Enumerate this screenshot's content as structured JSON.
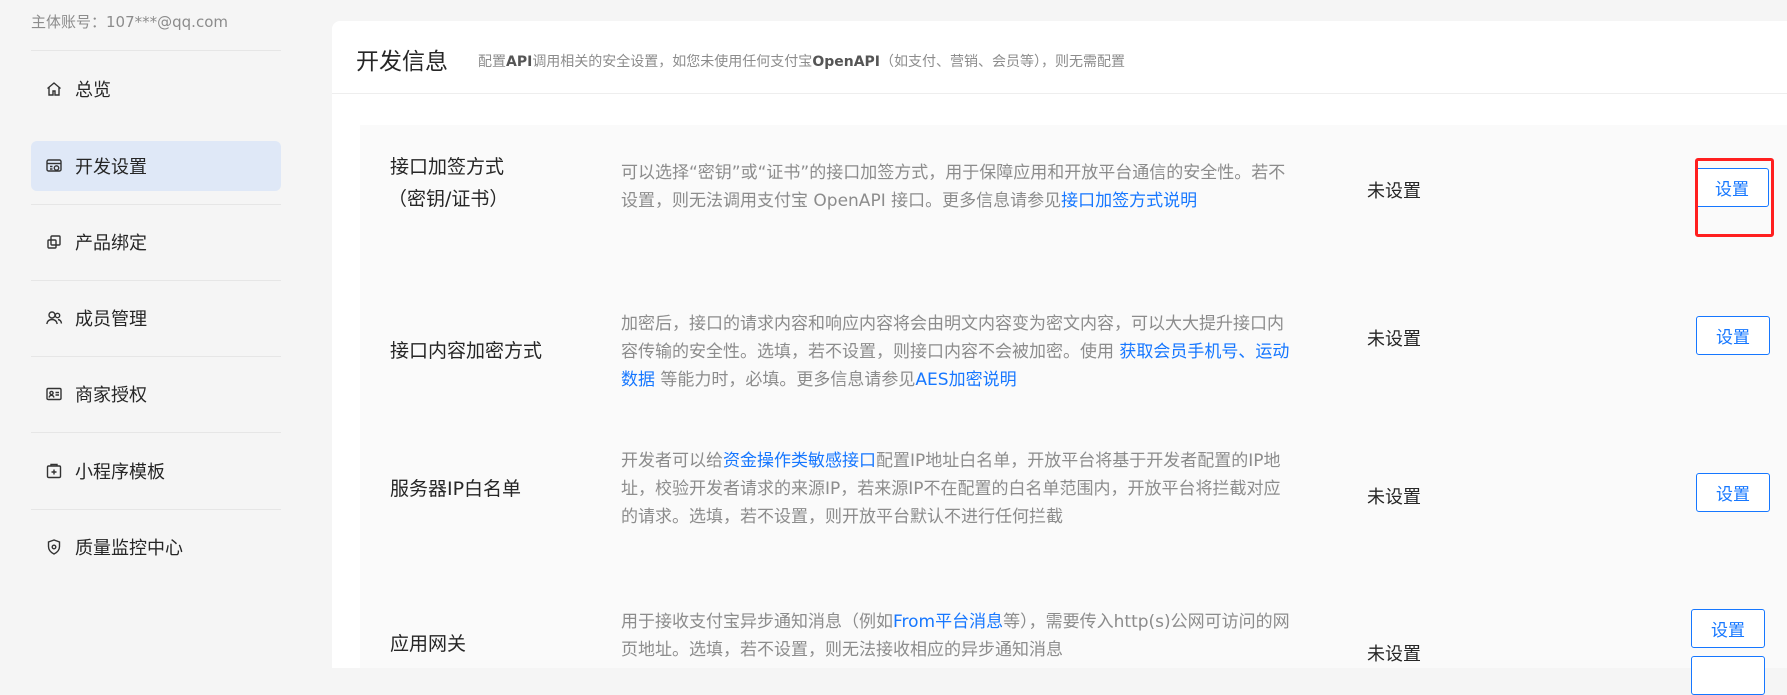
{
  "sidebar": {
    "account_label": "主体账号：107***@qq.com",
    "items": [
      {
        "label": "总览",
        "icon": "home-icon",
        "active": false
      },
      {
        "label": "开发设置",
        "icon": "dev-settings-icon",
        "active": true
      },
      {
        "label": "产品绑定",
        "icon": "product-bind-icon",
        "active": false
      },
      {
        "label": "成员管理",
        "icon": "members-icon",
        "active": false
      },
      {
        "label": "商家授权",
        "icon": "merchant-auth-icon",
        "active": false
      },
      {
        "label": "小程序模板",
        "icon": "miniapp-template-icon",
        "active": false
      },
      {
        "label": "质量监控中心",
        "icon": "shield-icon",
        "active": false
      }
    ]
  },
  "header": {
    "title": "开发信息",
    "desc_prefix": "配置",
    "desc_api": "API",
    "desc_middle": "调用相关的安全设置，如您未使用任何支付宝",
    "desc_openapi": "OpenAPI",
    "desc_suffix": "（如支付、营销、会员等），则无需配置"
  },
  "rows": [
    {
      "name_line1": "接口加签方式",
      "name_line2": "（密钥/证书）",
      "desc_line1": "可以选择“密钥”或“证书”的接口加签方式，用于保障应用和开放平台通信的安全性。若不",
      "desc_line2_text": "设置，则无法调用支付宝 OpenAPI 接口。更多信息请参见",
      "desc_line2_link": "接口加签方式说明",
      "status": "未设置",
      "button": "设置"
    },
    {
      "name": "接口内容加密方式",
      "desc_line1": "加密后，接口的请求内容和响应内容将会由明文内容变为密文内容，可以大大提升接口内",
      "desc_line2_text": "容传输的安全性。选填，若不设置，则接口内容不会被加密。使用 ",
      "desc_line2_link1": "获取会员手机号",
      "desc_line2_sep": "、",
      "desc_line2_link2": "运动",
      "desc_line3_link": "数据",
      "desc_line3_text": " 等能力时，必填。更多信息请参见",
      "desc_line3_link2": "AES加密说明",
      "status": "未设置",
      "button": "设置"
    },
    {
      "name": "服务器IP白名单",
      "desc_line1_text": "开发者可以给",
      "desc_line1_link": "资金操作类敏感接口",
      "desc_line1_rest": "配置IP地址白名单，开放平台将基于开发者配置的IP地",
      "desc_line2": "址，校验开发者请求的来源IP，若来源IP不在配置的白名单范围内，开放平台将拦截对应",
      "desc_line3": "的请求。选填，若不设置，则开放平台默认不进行任何拦截",
      "status": "未设置",
      "button": "设置"
    },
    {
      "name": "应用网关",
      "desc_line1_text": "用于接收支付宝异步通知消息（例如",
      "desc_line1_link": "From平台消息",
      "desc_line1_rest": "等），需要传入http(s)公网可访问的网",
      "desc_line2": "页地址。选填，若不设置，则无法接收相应的异步通知消息",
      "status": "未设置",
      "button": "设置"
    }
  ],
  "colors": {
    "accent": "#1677ff",
    "highlight": "#ff1f1f",
    "active_nav_bg": "#dfe8f7"
  }
}
